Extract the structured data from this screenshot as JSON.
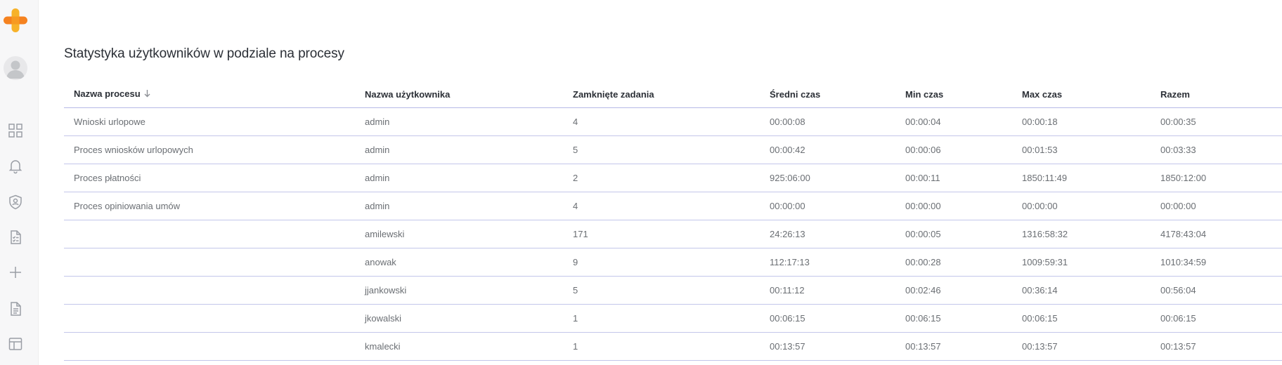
{
  "sidebar": {
    "logo_icon": "plus-logo-icon",
    "avatar_icon": "user-avatar-icon",
    "nav": [
      {
        "icon": "dashboard-grid-icon"
      },
      {
        "icon": "bell-icon"
      },
      {
        "icon": "shield-user-icon"
      },
      {
        "icon": "task-list-icon"
      },
      {
        "icon": "plus-icon"
      },
      {
        "icon": "document-icon"
      },
      {
        "icon": "layout-icon"
      }
    ]
  },
  "page": {
    "title": "Statystyka użytkowników w podziale na procesy"
  },
  "table": {
    "headers": {
      "process": "Nazwa procesu",
      "user": "Nazwa użytkownika",
      "closed": "Zamknięte zadania",
      "avg": "Średni czas",
      "min": "Min czas",
      "max": "Max czas",
      "total": "Razem"
    },
    "sort_icon": "arrow-down-icon",
    "rows": [
      {
        "process": "Wnioski urlopowe",
        "user": "admin",
        "closed": "4",
        "avg": "00:00:08",
        "min": "00:00:04",
        "max": "00:00:18",
        "total": "00:00:35"
      },
      {
        "process": "Proces wniosków urlopowych",
        "user": "admin",
        "closed": "5",
        "avg": "00:00:42",
        "min": "00:00:06",
        "max": "00:01:53",
        "total": "00:03:33"
      },
      {
        "process": "Proces płatności",
        "user": "admin",
        "closed": "2",
        "avg": "925:06:00",
        "min": "00:00:11",
        "max": "1850:11:49",
        "total": "1850:12:00"
      },
      {
        "process": "Proces opiniowania umów",
        "user": "admin",
        "closed": "4",
        "avg": "00:00:00",
        "min": "00:00:00",
        "max": "00:00:00",
        "total": "00:00:00"
      },
      {
        "process": "",
        "user": "amilewski",
        "closed": "171",
        "avg": "24:26:13",
        "min": "00:00:05",
        "max": "1316:58:32",
        "total": "4178:43:04"
      },
      {
        "process": "",
        "user": "anowak",
        "closed": "9",
        "avg": "112:17:13",
        "min": "00:00:28",
        "max": "1009:59:31",
        "total": "1010:34:59"
      },
      {
        "process": "",
        "user": "jjankowski",
        "closed": "5",
        "avg": "00:11:12",
        "min": "00:02:46",
        "max": "00:36:14",
        "total": "00:56:04"
      },
      {
        "process": "",
        "user": "jkowalski",
        "closed": "1",
        "avg": "00:06:15",
        "min": "00:06:15",
        "max": "00:06:15",
        "total": "00:06:15"
      },
      {
        "process": "",
        "user": "kmalecki",
        "closed": "1",
        "avg": "00:13:57",
        "min": "00:13:57",
        "max": "00:13:57",
        "total": "00:13:57"
      }
    ]
  }
}
